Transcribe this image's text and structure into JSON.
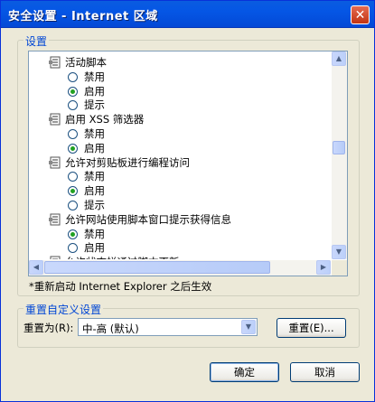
{
  "window": {
    "title": "安全设置 - Internet 区域",
    "close_glyph": "✕"
  },
  "settings_group": {
    "legend": "设置",
    "items": [
      {
        "kind": "category",
        "label": "活动脚本",
        "icon": "settings-category-icon"
      },
      {
        "kind": "option",
        "label": "禁用",
        "selected": false
      },
      {
        "kind": "option",
        "label": "启用",
        "selected": true
      },
      {
        "kind": "option",
        "label": "提示",
        "selected": false
      },
      {
        "kind": "category",
        "label": "启用 XSS 筛选器",
        "icon": "settings-category-icon"
      },
      {
        "kind": "option",
        "label": "禁用",
        "selected": false
      },
      {
        "kind": "option",
        "label": "启用",
        "selected": true
      },
      {
        "kind": "category",
        "label": "允许对剪贴板进行编程访问",
        "icon": "settings-category-icon"
      },
      {
        "kind": "option",
        "label": "禁用",
        "selected": false
      },
      {
        "kind": "option",
        "label": "启用",
        "selected": true
      },
      {
        "kind": "option",
        "label": "提示",
        "selected": false
      },
      {
        "kind": "category",
        "label": "允许网站使用脚本窗口提示获得信息",
        "icon": "settings-category-icon"
      },
      {
        "kind": "option",
        "label": "禁用",
        "selected": true
      },
      {
        "kind": "option",
        "label": "启用",
        "selected": false
      },
      {
        "kind": "category",
        "label": "允许状态栏通过脚本更新",
        "icon": "settings-category-icon"
      }
    ],
    "scroll_up_glyph": "▲",
    "scroll_down_glyph": "▼",
    "scroll_left_glyph": "◀",
    "scroll_right_glyph": "▶",
    "note": "*重新启动 Internet Explorer 之后生效"
  },
  "reset_group": {
    "legend": "重置自定义设置",
    "reset_to_label": "重置为(R):",
    "combo_value": "中-高 (默认)",
    "combo_arrow_glyph": "▼",
    "reset_button": "重置(E)..."
  },
  "footer": {
    "ok_button": "确定",
    "cancel_button": "取消"
  }
}
